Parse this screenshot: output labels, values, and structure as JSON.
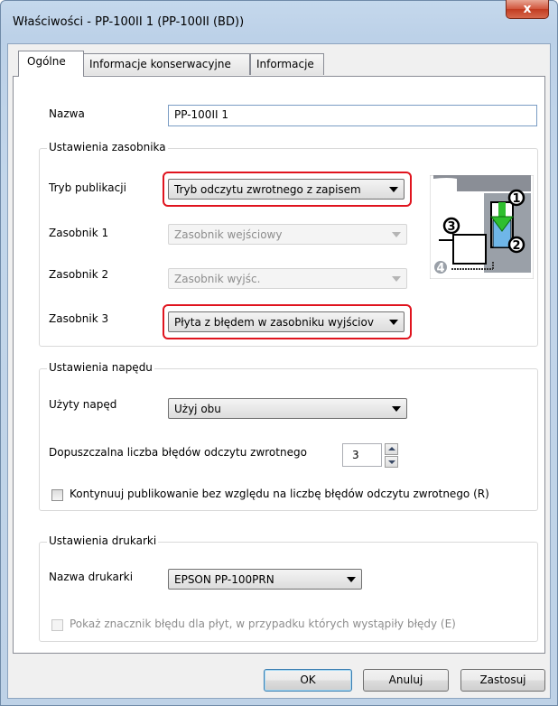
{
  "window": {
    "title": "Właściwości - PP-100II 1 (PP-100II (BD))",
    "close_label": "x"
  },
  "tabs": [
    {
      "label": "Ogólne",
      "active": true
    },
    {
      "label": "Informacje konserwacyjne",
      "active": false
    },
    {
      "label": "Informacje",
      "active": false
    }
  ],
  "name": {
    "label": "Nazwa",
    "value": "PP-100II 1"
  },
  "tray_settings": {
    "title": "Ustawienia zasobnika",
    "mode": {
      "label": "Tryb publikacji",
      "value": "Tryb odczytu zwrotnego z zapisem"
    },
    "tray1": {
      "label": "Zasobnik 1",
      "value": "Zasobnik wejściowy"
    },
    "tray2": {
      "label": "Zasobnik 2",
      "value": "Zasobnik wyjśc."
    },
    "tray3": {
      "label": "Zasobnik 3",
      "value": "Płyta z błędem w zasobniku wyjściov"
    },
    "diagram_numbers": [
      "1",
      "2",
      "3",
      "4"
    ]
  },
  "drive_settings": {
    "title": "Ustawienia napędu",
    "drive": {
      "label": "Użyty napęd",
      "value": "Użyj obu"
    },
    "errors": {
      "label": "Dopuszczalna liczba błędów odczytu zwrotnego",
      "value": "3"
    },
    "continue_checkbox": {
      "label": "Kontynuuj publikowanie bez względu na liczbę błędów odczytu zwrotnego (R)",
      "checked": false
    }
  },
  "printer_settings": {
    "title": "Ustawienia drukarki",
    "printer": {
      "label": "Nazwa drukarki",
      "value": "EPSON PP-100PRN"
    },
    "error_mark_checkbox": {
      "label": "Pokaż znacznik błędu dla płyt, w przypadku których wystąpiły błędy (E)",
      "checked": false,
      "enabled": false
    }
  },
  "buttons": {
    "ok": "OK",
    "cancel": "Anuluj",
    "apply": "Zastosuj"
  },
  "colors": {
    "highlight": "#e0141e",
    "arrow_green": "#2fbf2f",
    "disc_blue": "#6fb6e8"
  }
}
